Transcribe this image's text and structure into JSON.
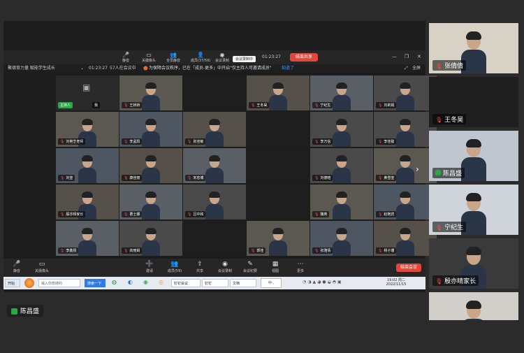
{
  "top_toolbar": {
    "mute": "静音",
    "camera_off": "关摄像头",
    "mute_all": "全员静音",
    "members": "成员(37/59)",
    "record": "会议录制",
    "timer": "01:23:27",
    "end_meeting": "结束共享"
  },
  "recording_badge": "会议录制中",
  "info_bar": {
    "title": "聚德育力量  赋能学生成长",
    "elapsed": "01:23:27",
    "count": "57人在会议中",
    "notice": "为保障会议秩序，已在「成员-更多」中开启\"仅主持人可邀请成员\"",
    "dismiss": "知道了",
    "fullscreen": "全屏"
  },
  "host_tile": {
    "name": "主持人",
    "self": "我"
  },
  "grid": [
    [
      "",
      "王娇娇",
      "",
      "王冬昊",
      "宁纪生",
      "刘莉娟"
    ],
    [
      "刘艳芝老师",
      "李孟阳",
      "张佳敏",
      "",
      "李万信",
      "李佳懿"
    ],
    [
      "刘莹",
      "康佳丽",
      "宋忠博",
      "",
      "刘德暄",
      "黄雪莹"
    ],
    [
      "殷亦晴家长",
      "曹士娜",
      "吕中和",
      "",
      "魏英",
      "赵艳宾"
    ],
    [
      "李鑫扬",
      "高丽娟",
      "",
      "郭佳",
      "张雅倩",
      "杨子珊"
    ]
  ],
  "bottom_toolbar": {
    "mute": "静音",
    "camera": "关摄像头",
    "invite": "邀请",
    "members": "成员(59)",
    "share": "共享",
    "record": "会议录制",
    "minutes": "会议纪要",
    "view": "视图",
    "more": "更多",
    "end": "结束会议"
  },
  "taskbar": {
    "start": "开始",
    "input_hint": "输入你想搜的",
    "search": "搜索一下",
    "app1": "钉钉会议",
    "app2": "钉钉",
    "app3": "文档",
    "time": "19:02 周二",
    "date": "2022/11/15"
  },
  "side_panel": [
    "张倩倩",
    "王冬昊",
    "陈昌盛",
    "宁纪生",
    "殷亦晴家长",
    ""
  ],
  "active_speaker": "陈昌盛"
}
